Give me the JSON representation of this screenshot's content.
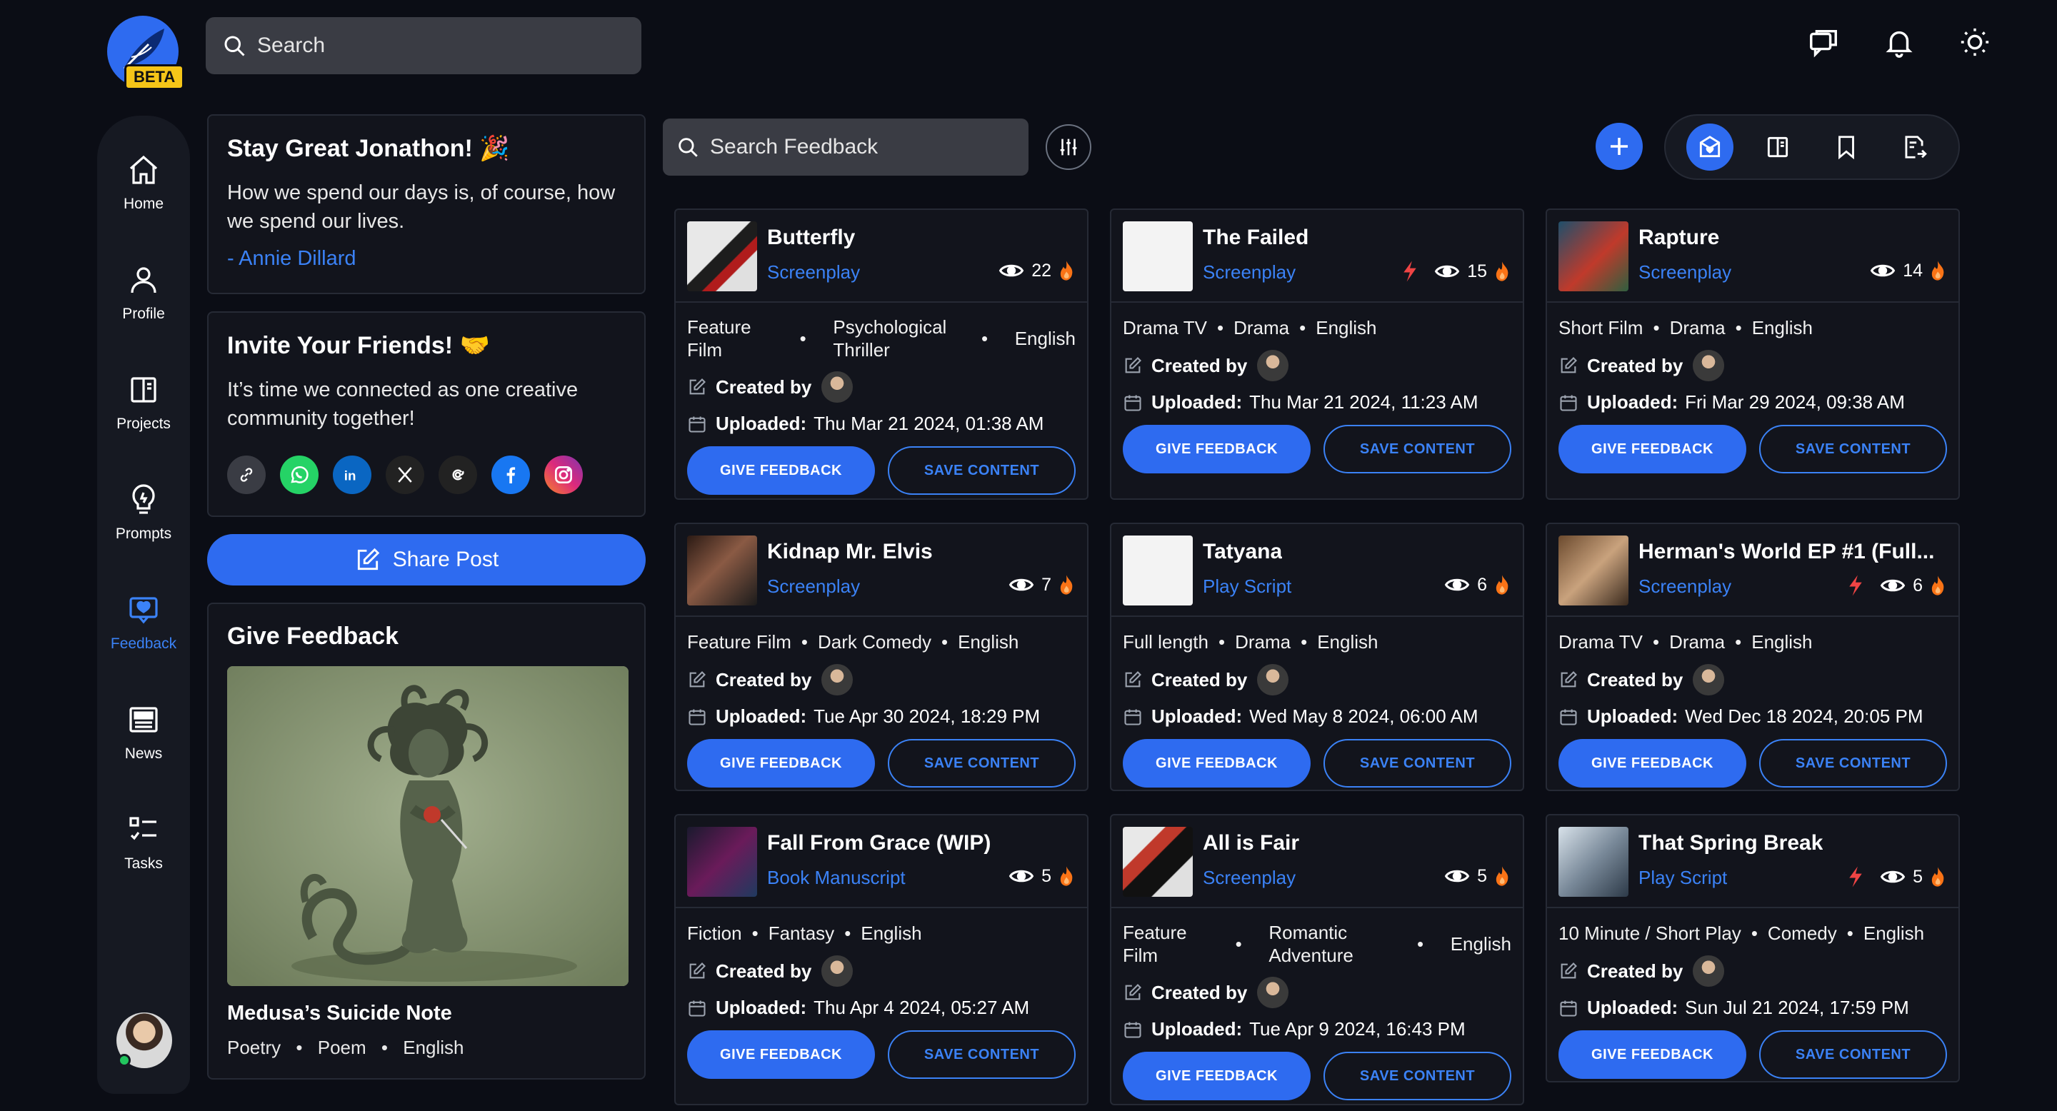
{
  "header": {
    "badge": "BETA",
    "search_placeholder": "Search"
  },
  "nav": {
    "items": [
      {
        "label": "Home",
        "icon": "home-icon"
      },
      {
        "label": "Profile",
        "icon": "user-icon"
      },
      {
        "label": "Projects",
        "icon": "book-icon"
      },
      {
        "label": "Prompts",
        "icon": "lightbulb-icon"
      },
      {
        "label": "Feedback",
        "icon": "feedback-icon",
        "active": true
      },
      {
        "label": "News",
        "icon": "newspaper-icon"
      },
      {
        "label": "Tasks",
        "icon": "tasks-icon"
      }
    ]
  },
  "quote": {
    "title": "Stay Great Jonathon! 🎉",
    "text": "How we spend our days is, of course, how we spend our lives.",
    "author": "- Annie Dillard"
  },
  "invite": {
    "title": "Invite Your Friends! 🤝",
    "text": "It’s time we connected as one creative community together!"
  },
  "share": {
    "label": "Share Post"
  },
  "give_feedback": {
    "title": "Give Feedback",
    "item_title": "Medusa’s Suicide Note",
    "tags": [
      "Poetry",
      "Poem",
      "English"
    ]
  },
  "feedback_toolbar": {
    "search_placeholder": "Search Feedback"
  },
  "labels": {
    "created_by": "Created by",
    "uploaded": "Uploaded:",
    "give_feedback": "GIVE FEEDBACK",
    "save_content": "SAVE CONTENT"
  },
  "cards": [
    {
      "title": "Butterfly",
      "type": "Screenplay",
      "views": "22",
      "tags": [
        "Feature Film",
        "Psychological Thriller",
        "English"
      ],
      "uploaded": "Thu Mar 21 2024, 01:38 AM"
    },
    {
      "title": "The Failed",
      "type": "Screenplay",
      "views": "15",
      "tags": [
        "Drama TV",
        "Drama",
        "English"
      ],
      "uploaded": "Thu Mar 21 2024, 11:23 AM"
    },
    {
      "title": "Rapture",
      "type": "Screenplay",
      "views": "14",
      "tags": [
        "Short Film",
        "Drama",
        "English"
      ],
      "uploaded": "Fri Mar 29 2024, 09:38 AM"
    },
    {
      "title": "Kidnap Mr. Elvis",
      "type": "Screenplay",
      "views": "7",
      "tags": [
        "Feature Film",
        "Dark Comedy",
        "English"
      ],
      "uploaded": "Tue Apr 30 2024, 18:29 PM"
    },
    {
      "title": "Tatyana",
      "type": "Play Script",
      "views": "6",
      "tags": [
        "Full length",
        "Drama",
        "English"
      ],
      "uploaded": "Wed May 8 2024, 06:00 AM"
    },
    {
      "title": "Herman's World EP #1 (Full...",
      "type": "Screenplay",
      "views": "6",
      "tags": [
        "Drama TV",
        "Drama",
        "English"
      ],
      "uploaded": "Wed Dec 18 2024, 20:05 PM"
    },
    {
      "title": "Fall From Grace (WIP)",
      "type": "Book Manuscript",
      "views": "5",
      "tags": [
        "Fiction",
        "Fantasy",
        "English"
      ],
      "uploaded": "Thu Apr 4 2024, 05:27 AM"
    },
    {
      "title": "All is Fair",
      "type": "Screenplay",
      "views": "5",
      "tags": [
        "Feature Film",
        "Romantic Adventure",
        "English"
      ],
      "uploaded": "Tue Apr 9 2024, 16:43 PM"
    },
    {
      "title": "That Spring Break",
      "type": "Play Script",
      "views": "5",
      "tags": [
        "10 Minute / Short Play",
        "Comedy",
        "English"
      ],
      "uploaded": "Sun Jul 21 2024, 17:59 PM"
    }
  ],
  "colors": {
    "accent": "#2e6bf0",
    "link": "#3b82f6",
    "background": "#0b0d15",
    "panel": "#12141c",
    "fire": "#f97316",
    "bolt": "#ef4444"
  }
}
